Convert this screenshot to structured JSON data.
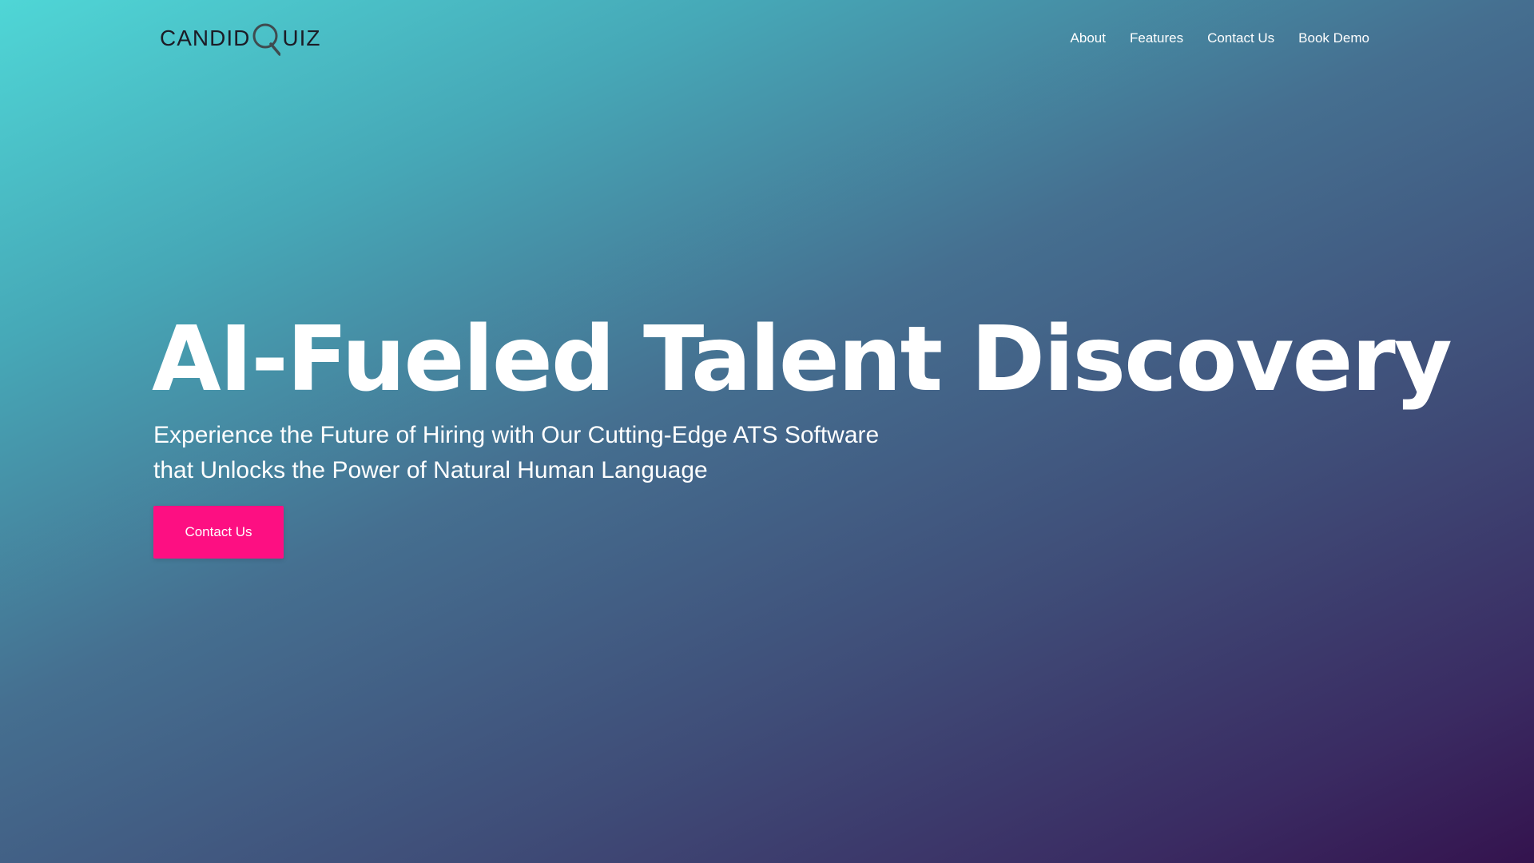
{
  "header": {
    "logo": {
      "text_before": "CANDID",
      "text_after": "UIZ",
      "icon": "magnifier-q-icon",
      "color": "#1c1c26"
    },
    "nav": [
      {
        "label": "About"
      },
      {
        "label": "Features"
      },
      {
        "label": "Contact Us"
      },
      {
        "label": "Book Demo"
      }
    ]
  },
  "hero": {
    "title": "AI-Fueled Talent Discovery",
    "subtitle_line1": "Experience the Future of Hiring with Our Cutting-Edge ATS Software",
    "subtitle_line2": "that Unlocks the Power of Natural Human Language",
    "cta_label": "Contact Us"
  },
  "colors": {
    "gradient_start": "#4fd6d6",
    "gradient_end": "#34134e",
    "accent": "#fd0f82",
    "text": "#ffffff"
  }
}
